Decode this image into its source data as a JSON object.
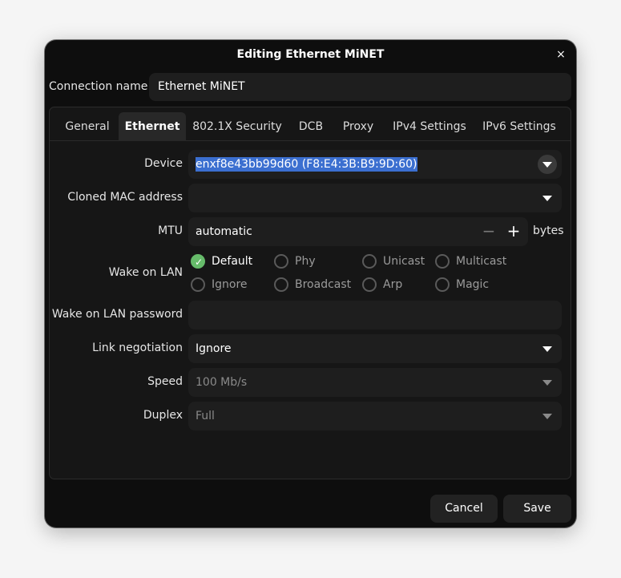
{
  "window": {
    "title": "Editing Ethernet MiNET",
    "close_glyph": "×"
  },
  "connection": {
    "label": "Connection name",
    "value": "Ethernet MiNET"
  },
  "tabs": [
    {
      "label": "General"
    },
    {
      "label": "Ethernet",
      "active": true
    },
    {
      "label": "802.1X Security"
    },
    {
      "label": "DCB"
    },
    {
      "label": "Proxy"
    },
    {
      "label": "IPv4 Settings"
    },
    {
      "label": "IPv6 Settings"
    }
  ],
  "ethernet": {
    "device": {
      "label": "Device",
      "value": "enxf8e43bb99d60 (F8:E4:3B:B9:9D:60)"
    },
    "cloned_mac": {
      "label": "Cloned MAC address",
      "value": ""
    },
    "mtu": {
      "label": "MTU",
      "value": "automatic",
      "minus": "−",
      "plus": "+",
      "unit": "bytes"
    },
    "wake_on_lan": {
      "label": "Wake on LAN",
      "options": [
        {
          "label": "Default",
          "checked": true
        },
        {
          "label": "Phy",
          "checked": false
        },
        {
          "label": "Unicast",
          "checked": false
        },
        {
          "label": "Multicast",
          "checked": false
        },
        {
          "label": "Ignore",
          "checked": false
        },
        {
          "label": "Broadcast",
          "checked": false
        },
        {
          "label": "Arp",
          "checked": false
        },
        {
          "label": "Magic",
          "checked": false
        }
      ]
    },
    "wol_password": {
      "label": "Wake on LAN password",
      "value": ""
    },
    "link_negotiation": {
      "label": "Link negotiation",
      "value": "Ignore"
    },
    "speed": {
      "label": "Speed",
      "value": "100 Mb/s"
    },
    "duplex": {
      "label": "Duplex",
      "value": "Full"
    }
  },
  "buttons": {
    "cancel": "Cancel",
    "save": "Save"
  },
  "colors": {
    "accent_check": "#66bb6a",
    "selection": "#3b6fd0",
    "dialog_bg": "#0e0e0e"
  }
}
